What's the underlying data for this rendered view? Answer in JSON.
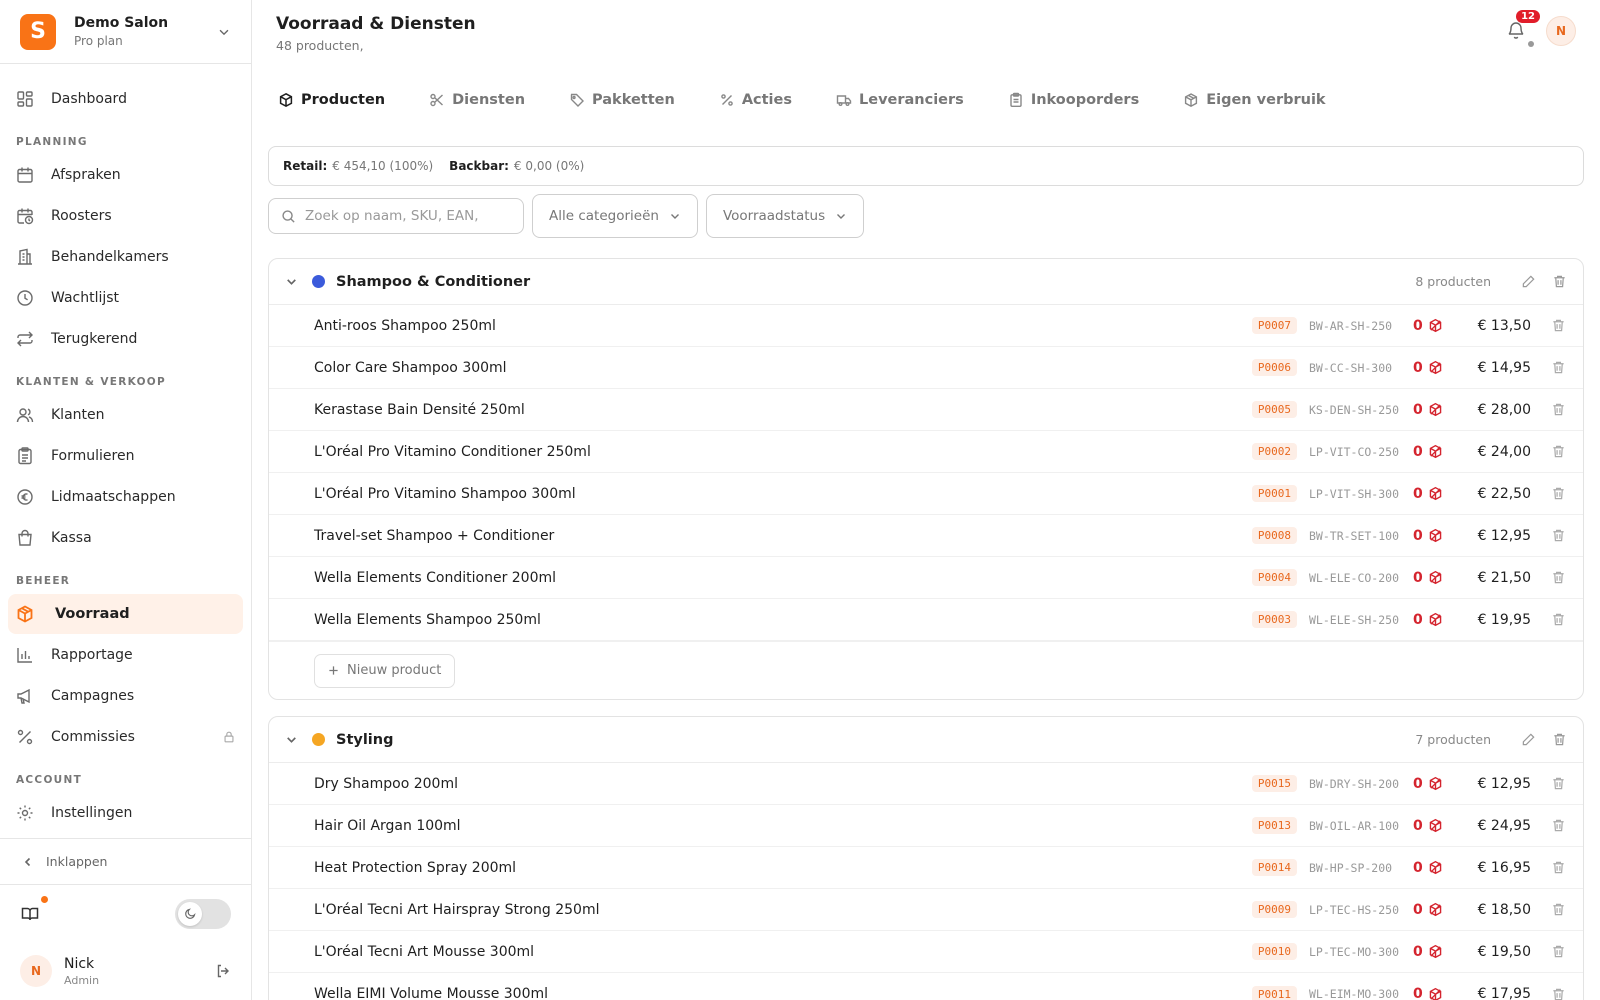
{
  "org": {
    "logo": "S",
    "name": "Demo Salon",
    "plan": "Pro plan"
  },
  "nav": {
    "dashboard": "Dashboard",
    "planning_section": "PLANNING",
    "planning": [
      "Afspraken",
      "Roosters",
      "Behandelkamers",
      "Wachtlijst",
      "Terugkerend"
    ],
    "sales_section": "KLANTEN & VERKOOP",
    "sales": [
      "Klanten",
      "Formulieren",
      "Lidmaatschappen",
      "Kassa"
    ],
    "manage_section": "BEHEER",
    "manage": [
      "Voorraad",
      "Rapportage",
      "Campagnes",
      "Commissies"
    ],
    "account_section": "ACCOUNT",
    "account": [
      "Instellingen"
    ],
    "collapse": "Inklappen"
  },
  "user": {
    "initial": "N",
    "name": "Nick",
    "role": "Admin"
  },
  "header": {
    "title": "Voorraad & Diensten",
    "subtitle": "48 producten,",
    "notifications": "12",
    "avatar": "N"
  },
  "tabs": [
    "Producten",
    "Diensten",
    "Pakketten",
    "Acties",
    "Leveranciers",
    "Inkooporders",
    "Eigen verbruik"
  ],
  "summary": {
    "retail_label": "Retail:",
    "retail_value": "€ 454,10 (100%)",
    "backbar_label": "Backbar:",
    "backbar_value": "€ 0,00 (0%)"
  },
  "filters": {
    "search_placeholder": "Zoek op naam, SKU, EAN,",
    "category": "Alle categorieën",
    "status": "Voorraadstatus"
  },
  "colors": {
    "accent": "#f97316",
    "shampoo_dot": "#3b5bdb",
    "styling_dot": "#f5a623",
    "stock_red": "#d4242e"
  },
  "groups": [
    {
      "name": "Shampoo & Conditioner",
      "count": "8 producten",
      "new_label": "Nieuw product",
      "products": [
        {
          "name": "Anti-roos Shampoo 250ml",
          "id": "P0007",
          "sku": "BW-AR-SH-250",
          "stock": "0",
          "price": "€ 13,50"
        },
        {
          "name": "Color Care Shampoo 300ml",
          "id": "P0006",
          "sku": "BW-CC-SH-300",
          "stock": "0",
          "price": "€ 14,95"
        },
        {
          "name": "Kerastase Bain Densité 250ml",
          "id": "P0005",
          "sku": "KS-DEN-SH-250",
          "stock": "0",
          "price": "€ 28,00"
        },
        {
          "name": "L'Oréal Pro Vitamino Conditioner 250ml",
          "id": "P0002",
          "sku": "LP-VIT-CO-250",
          "stock": "0",
          "price": "€ 24,00"
        },
        {
          "name": "L'Oréal Pro Vitamino Shampoo 300ml",
          "id": "P0001",
          "sku": "LP-VIT-SH-300",
          "stock": "0",
          "price": "€ 22,50"
        },
        {
          "name": "Travel-set Shampoo + Conditioner",
          "id": "P0008",
          "sku": "BW-TR-SET-100",
          "stock": "0",
          "price": "€ 12,95"
        },
        {
          "name": "Wella Elements Conditioner 200ml",
          "id": "P0004",
          "sku": "WL-ELE-CO-200",
          "stock": "0",
          "price": "€ 21,50"
        },
        {
          "name": "Wella Elements Shampoo 250ml",
          "id": "P0003",
          "sku": "WL-ELE-SH-250",
          "stock": "0",
          "price": "€ 19,95"
        }
      ]
    },
    {
      "name": "Styling",
      "count": "7 producten",
      "products": [
        {
          "name": "Dry Shampoo 200ml",
          "id": "P0015",
          "sku": "BW-DRY-SH-200",
          "stock": "0",
          "price": "€ 12,95"
        },
        {
          "name": "Hair Oil Argan 100ml",
          "id": "P0013",
          "sku": "BW-OIL-AR-100",
          "stock": "0",
          "price": "€ 24,95"
        },
        {
          "name": "Heat Protection Spray 200ml",
          "id": "P0014",
          "sku": "BW-HP-SP-200",
          "stock": "0",
          "price": "€ 16,95"
        },
        {
          "name": "L'Oréal Tecni Art Hairspray Strong 250ml",
          "id": "P0009",
          "sku": "LP-TEC-HS-250",
          "stock": "0",
          "price": "€ 18,50"
        },
        {
          "name": "L'Oréal Tecni Art Mousse 300ml",
          "id": "P0010",
          "sku": "LP-TEC-MO-300",
          "stock": "0",
          "price": "€ 19,50"
        },
        {
          "name": "Wella EIMI Volume Mousse 300ml",
          "id": "P0011",
          "sku": "WL-EIM-MO-300",
          "stock": "0",
          "price": "€ 17,95"
        }
      ]
    }
  ]
}
